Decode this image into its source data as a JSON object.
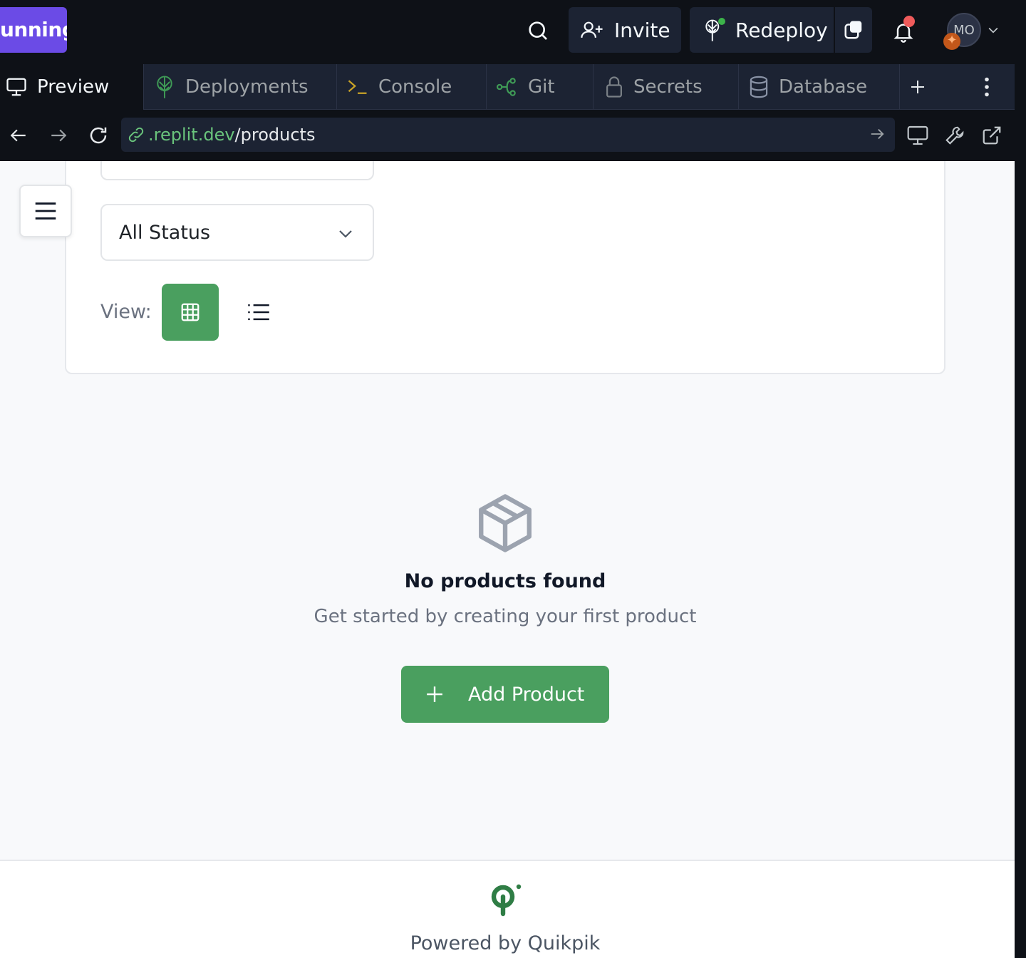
{
  "topbar": {
    "run_label": "unning",
    "invite_label": "Invite",
    "redeploy_label": "Redeploy",
    "avatar_initials": "MO"
  },
  "tabs": [
    {
      "label": "Preview",
      "icon": "monitor-icon"
    },
    {
      "label": "Deployments",
      "icon": "deployments-icon"
    },
    {
      "label": "Console",
      "icon": "terminal-icon"
    },
    {
      "label": "Git",
      "icon": "git-icon"
    },
    {
      "label": "Secrets",
      "icon": "lock-icon"
    },
    {
      "label": "Database",
      "icon": "database-icon"
    }
  ],
  "urlbar": {
    "host": ".replit.dev",
    "path": "/products"
  },
  "filters": {
    "status_value": "All Status",
    "view_label": "View:",
    "view_mode": "grid"
  },
  "empty_state": {
    "title": "No products found",
    "subtitle": "Get started by creating your first product",
    "add_button": "Add Product"
  },
  "footer": {
    "powered_by": "Powered by Quikpik"
  },
  "colors": {
    "ide_bg": "#0e1117",
    "ide_panel": "#1c2333",
    "run_accent": "#6b4be6",
    "primary_green": "#4a9f5f",
    "notification_red": "#ef5b5b"
  }
}
